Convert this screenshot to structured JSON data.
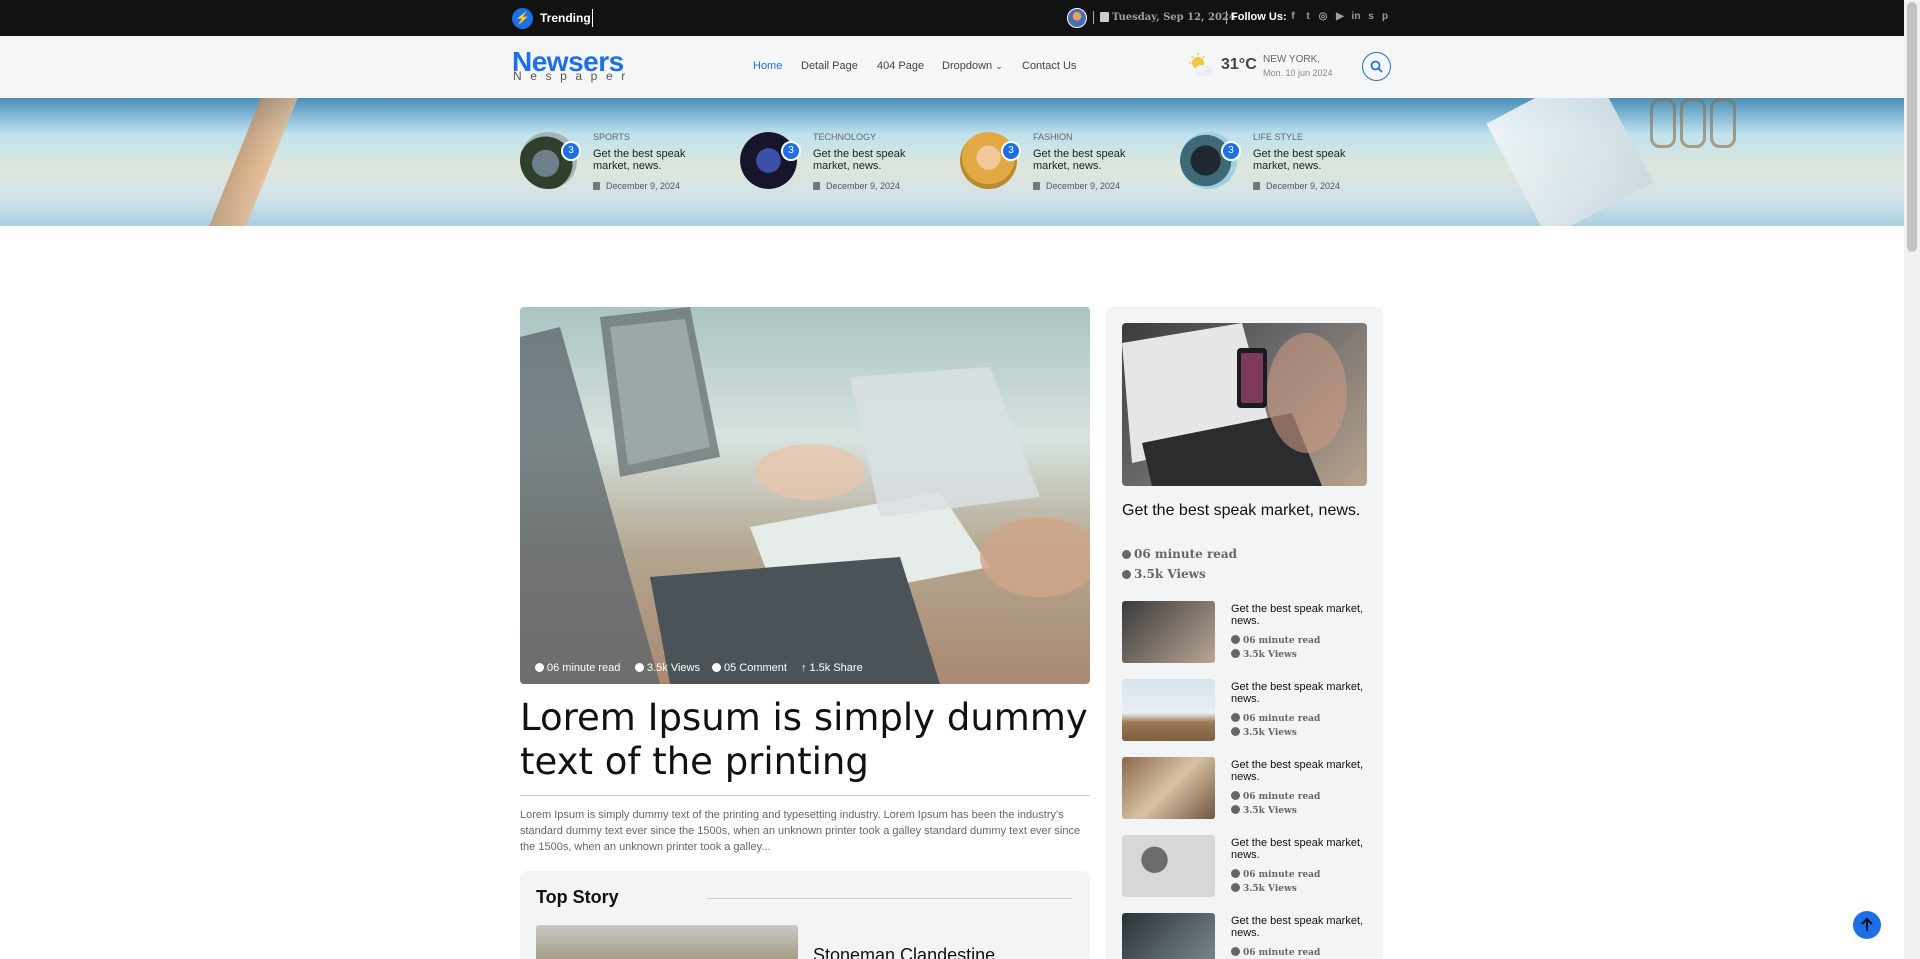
{
  "topbar": {
    "trending_label": "Trending",
    "date": "Tuesday, Sep 12, 2024",
    "follow_label": "Follow Us:",
    "socials": [
      "facebook-icon",
      "twitter-icon",
      "instagram-icon",
      "youtube-icon",
      "linkedin-icon",
      "skype-icon",
      "pinterest-icon"
    ],
    "social_glyphs": [
      "f",
      "t",
      "◎",
      "▶",
      "in",
      "s",
      "p"
    ]
  },
  "header": {
    "logo": "Newsers",
    "logo_sub": "Nespaper",
    "nav": [
      {
        "label": "Home",
        "active": true
      },
      {
        "label": "Detail Page",
        "active": false
      },
      {
        "label": "404 Page",
        "active": false
      },
      {
        "label": "Dropdown",
        "active": false
      },
      {
        "label": "Contact Us",
        "active": false
      }
    ],
    "weather": {
      "temp": "31°C",
      "city": "NEW YORK,",
      "date": "Mon. 10 jun 2024"
    }
  },
  "trending_cards": [
    {
      "category": "SPORTS",
      "badge": "3",
      "title": "Get the best speak market, news.",
      "date": "December 9, 2024"
    },
    {
      "category": "TECHNOLOGY",
      "badge": "3",
      "title": "Get the best speak market, news.",
      "date": "December 9, 2024"
    },
    {
      "category": "FASHION",
      "badge": "3",
      "title": "Get the best speak market, news.",
      "date": "December 9, 2024"
    },
    {
      "category": "LIFE STYLE",
      "badge": "3",
      "title": "Get the best speak market, news.",
      "date": "December 9, 2024"
    }
  ],
  "featured": {
    "read_time": "06 minute read",
    "views": "3.5k Views",
    "comments": "05 Comment",
    "shares": "1.5k Share",
    "title": "Lorem Ipsum is simply dummy text of the printing",
    "excerpt": "Lorem Ipsum is simply dummy text of the printing and typesetting industry. Lorem Ipsum has been the industry's standard dummy text ever since the 1500s, when an unknown printer took a galley standard dummy text ever since the 1500s, when an unknown printer took a galley..."
  },
  "top_story": {
    "heading": "Top Story",
    "story_title": "Stoneman Clandestine"
  },
  "sidebar": {
    "main": {
      "title": "Get the best speak market, news.",
      "read_time": "06 minute read",
      "views": "3.5k Views"
    },
    "items": [
      {
        "title": "Get the best speak market, news.",
        "read_time": "06 minute read",
        "views": "3.5k Views"
      },
      {
        "title": "Get the best speak market, news.",
        "read_time": "06 minute read",
        "views": "3.5k Views"
      },
      {
        "title": "Get the best speak market, news.",
        "read_time": "06 minute read",
        "views": "3.5k Views"
      },
      {
        "title": "Get the best speak market, news.",
        "read_time": "06 minute read",
        "views": "3.5k Views"
      },
      {
        "title": "Get the best speak market, news.",
        "read_time": "06 minute read",
        "views": ""
      }
    ]
  },
  "colors": {
    "accent": "#1c6fe8",
    "topbar": "#121212",
    "header": "#f5f6f8",
    "card": "#f3f4f6"
  }
}
